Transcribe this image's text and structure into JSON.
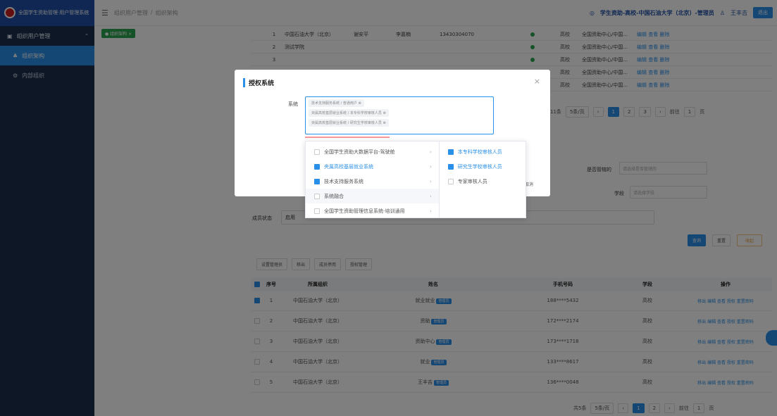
{
  "app": {
    "title": "全国学生资助管理·用户管理系统",
    "breadcrumb": [
      "组织用户管理",
      "组织架构"
    ],
    "header_school": "学生资助-高校-中国石油大学（北京）-管理员",
    "header_user": "王丰吉",
    "exit_label": "退出"
  },
  "sidebar": {
    "items": [
      {
        "label": "组织用户管理",
        "type": "parent"
      },
      {
        "label": "组织架构",
        "type": "active"
      },
      {
        "label": "内部组织",
        "type": "sub"
      }
    ]
  },
  "tab": {
    "label": "组织架构"
  },
  "top_rows": [
    {
      "no": "1",
      "org": "中国石油大学（北京）",
      "name": "谢安平",
      "pass": "李嘉楠",
      "phone": "13430304070",
      "level": "高校",
      "center": "全国资助中心/中国...",
      "ops": "编辑 查看 删除"
    },
    {
      "no": "2",
      "org": "测试学院",
      "name": "",
      "pass": "",
      "phone": "",
      "level": "高校",
      "center": "全国资助中心/中国...",
      "ops": "编辑 查看 删除"
    },
    {
      "no": "3",
      "org": "",
      "name": "",
      "pass": "",
      "phone": "",
      "level": "高校",
      "center": "全国资助中心/中国...",
      "ops": "编辑 查看 删除"
    },
    {
      "no": "4",
      "org": "",
      "name": "",
      "pass": "",
      "phone": "",
      "level": "高校",
      "center": "全国资助中心/中国...",
      "ops": "编辑 查看 删除"
    },
    {
      "no": "5",
      "org": "",
      "name": "",
      "pass": "",
      "phone": "",
      "level": "高校",
      "center": "全国资助中心/中国...",
      "ops": "编辑 查看 删除"
    }
  ],
  "pager1": {
    "total": "共11条",
    "size": "5条/页",
    "pages": [
      "1",
      "2",
      "3"
    ],
    "goto": "前往",
    "goto_val": "1",
    "page_unit": "页"
  },
  "filters": {
    "dept_label": "是否管辖的",
    "dept_placeholder": "请选择是否管辖的",
    "level_label": "学段",
    "level_placeholder": "请选择学段",
    "status_label": "成员状态",
    "status_value": "启用",
    "search_btn": "查询",
    "reset_btn": "重置",
    "fold_btn": "收起"
  },
  "actions": [
    "设置管理员",
    "移出",
    "成员停用",
    "授权管理"
  ],
  "users": {
    "headers": [
      "序号",
      "所属组织",
      "姓名",
      "手机号码",
      "学段",
      "操作"
    ],
    "rows": [
      {
        "no": "1",
        "org": "中国石油大学（北京）",
        "name": "就业就业",
        "tag": "管理员",
        "phone": "188****5432",
        "level": "高校",
        "ops": "移出 编辑 查看 授权 重置密码",
        "checked": true
      },
      {
        "no": "2",
        "org": "中国石油大学（北京）",
        "name": "资助",
        "tag": "管理员",
        "phone": "172****2174",
        "level": "高校",
        "ops": "移出 编辑 查看 授权 重置密码",
        "checked": false
      },
      {
        "no": "3",
        "org": "中国石油大学（北京）",
        "name": "资助中心",
        "tag": "管理员",
        "phone": "173****1718",
        "level": "高校",
        "ops": "移出 编辑 查看 授权 重置密码",
        "checked": false
      },
      {
        "no": "4",
        "org": "中国石油大学（北京）",
        "name": "就业",
        "tag": "管理员",
        "phone": "133****8617",
        "level": "高校",
        "ops": "移出 编辑 查看 授权 重置密码",
        "checked": false
      },
      {
        "no": "5",
        "org": "中国石油大学（北京）",
        "name": "王丰吉",
        "tag": "管理员",
        "phone": "136****0048",
        "level": "高校",
        "ops": "移出 编辑 查看 授权 重置密码",
        "checked": false
      }
    ]
  },
  "pager2": {
    "total": "共5条",
    "size": "5条/页",
    "pages": [
      "1",
      "2"
    ],
    "goto": "前往",
    "goto_val": "1",
    "page_unit": "页"
  },
  "modal": {
    "title": "授权系统",
    "close": "×",
    "sys_label": "系统",
    "selected_tags": [
      "技术支持服务系统 / 普通用户",
      "央属高校基层就业系统 / 本专科学校审核人员",
      "央属高校基层就业系统 / 研究生学校审核人员"
    ],
    "hidden_btn": "取消"
  },
  "cascader": {
    "col1": [
      {
        "label": "全国学生资助大数据平台-驾驶舱",
        "checked": false,
        "hover": false
      },
      {
        "label": "央属高校基层就业系统",
        "checked": true,
        "hover": false
      },
      {
        "label": "技术支持服务系统",
        "checked": true,
        "hover": false
      },
      {
        "label": "系统融合",
        "checked": false,
        "hover": true
      },
      {
        "label": "全国学生资助管理信息系统-培训通用",
        "checked": false,
        "hover": false
      }
    ],
    "col2": [
      {
        "label": "本专科学校审核人员",
        "checked": true
      },
      {
        "label": "研究生学校审核人员",
        "checked": true
      },
      {
        "label": "专家审核人员",
        "checked": false
      }
    ]
  },
  "colors": {
    "primary": "#2a8fe8",
    "sidebar": "#1c2f4d",
    "logo_bg": "#1e4fa5",
    "success": "#2da44e"
  }
}
